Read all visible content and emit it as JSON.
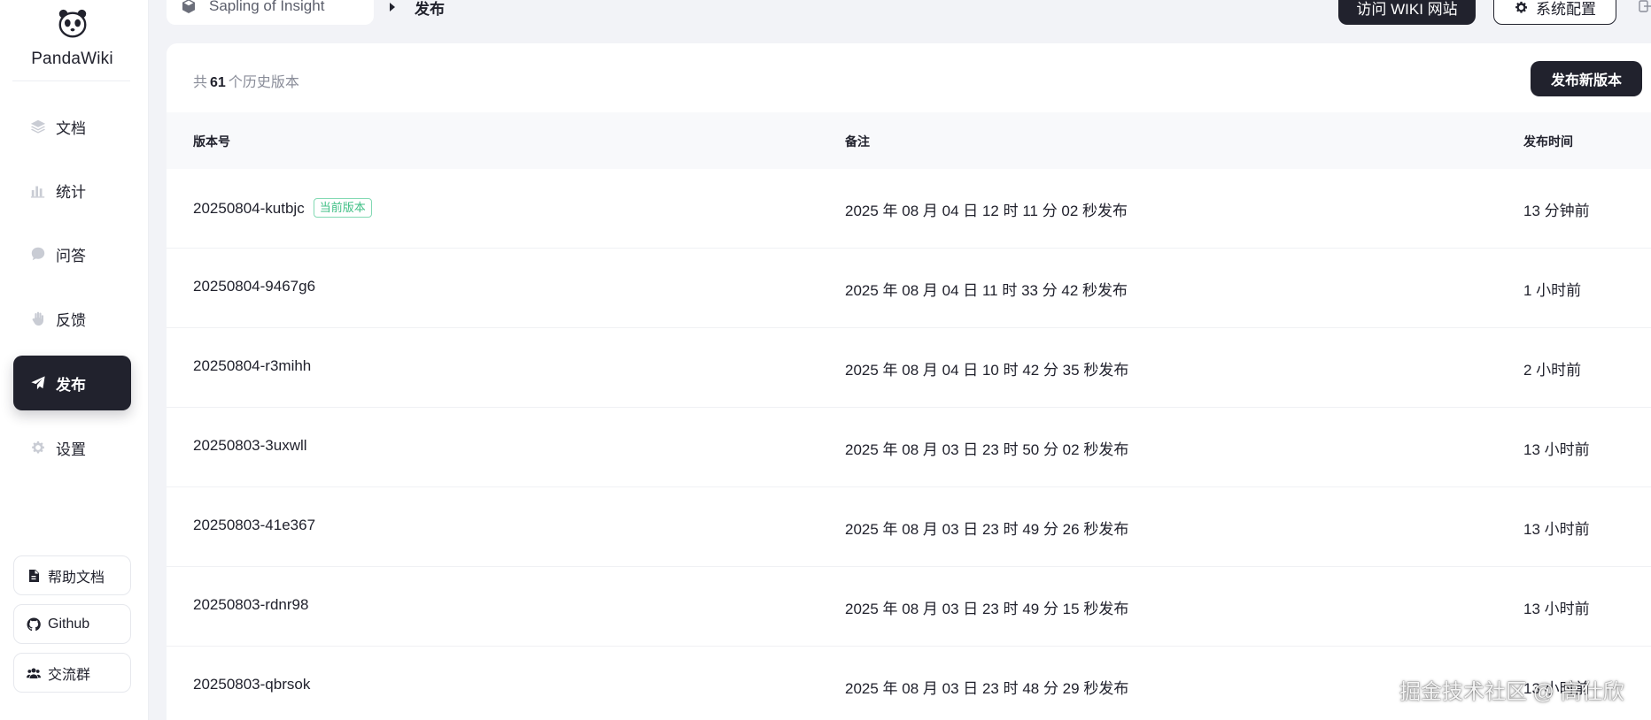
{
  "brand": {
    "name": "PandaWiki",
    "logo": "panda-icon"
  },
  "sidebar": {
    "items": [
      {
        "label": "文档",
        "icon": "layers-icon"
      },
      {
        "label": "统计",
        "icon": "bar-chart-icon"
      },
      {
        "label": "问答",
        "icon": "chat-bubble-icon"
      },
      {
        "label": "反馈",
        "icon": "hand-icon"
      },
      {
        "label": "发布",
        "icon": "send-icon",
        "active": true
      },
      {
        "label": "设置",
        "icon": "gear-icon"
      }
    ],
    "bottom": [
      {
        "label": "帮助文档",
        "icon": "document-icon"
      },
      {
        "label": "Github",
        "icon": "github-icon"
      },
      {
        "label": "交流群",
        "icon": "group-icon"
      }
    ]
  },
  "header": {
    "kb_name": "Sapling of Insight",
    "breadcrumb_current": "发布",
    "visit_label": "访问 WIKI 网站",
    "config_label": "系统配置"
  },
  "main": {
    "count_prefix": "共",
    "count": "61",
    "count_suffix": "个历史版本",
    "publish_label": "发布新版本",
    "columns": [
      "版本号",
      "备注",
      "发布时间"
    ],
    "current_badge": "当前版本",
    "rows": [
      {
        "version": "20250804-kutbjc",
        "note": "2025 年 08 月 04 日 12 时 11 分 02 秒发布",
        "time": "13 分钟前",
        "current": true
      },
      {
        "version": "20250804-9467g6",
        "note": "2025 年 08 月 04 日 11 时 33 分 42 秒发布",
        "time": "1 小时前"
      },
      {
        "version": "20250804-r3mihh",
        "note": "2025 年 08 月 04 日 10 时 42 分 35 秒发布",
        "time": "2 小时前"
      },
      {
        "version": "20250803-3uxwll",
        "note": "2025 年 08 月 03 日 23 时 50 分 02 秒发布",
        "time": "13 小时前"
      },
      {
        "version": "20250803-41e367",
        "note": "2025 年 08 月 03 日 23 时 49 分 26 秒发布",
        "time": "13 小时前"
      },
      {
        "version": "20250803-rdnr98",
        "note": "2025 年 08 月 03 日 23 时 49 分 15 秒发布",
        "time": "13 小时前"
      },
      {
        "version": "20250803-qbrsok",
        "note": "2025 年 08 月 03 日 23 时 48 分 29 秒发布",
        "time": "13 小时前"
      }
    ]
  },
  "watermark": "掘金技术社区 @ 高仕欣",
  "colors": {
    "dark": "#21222d",
    "accent_green": "#3fbf85",
    "background": "#f2f3f7"
  }
}
